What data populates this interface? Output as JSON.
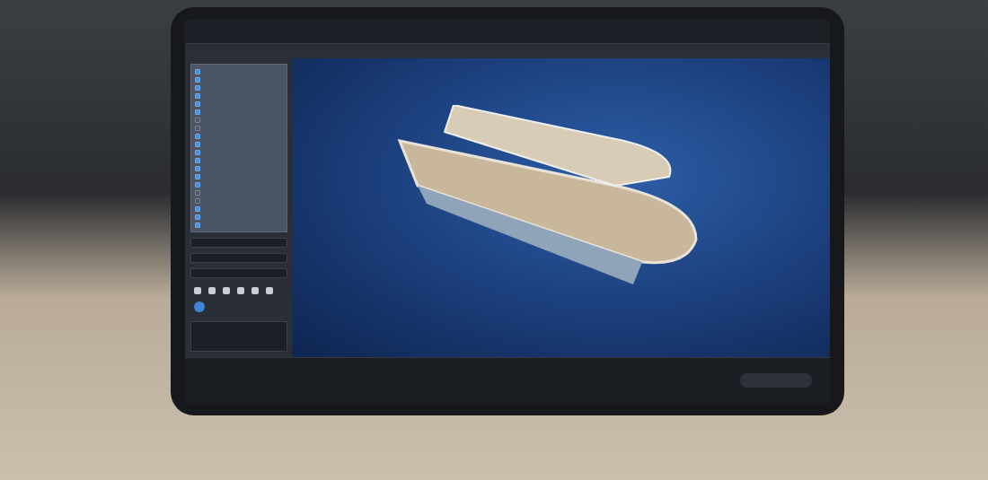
{
  "sidebar": {
    "tree": [
      {
        "checked": true
      },
      {
        "checked": true
      },
      {
        "checked": true
      },
      {
        "checked": true
      },
      {
        "checked": true
      },
      {
        "checked": true
      },
      {
        "checked": false
      },
      {
        "checked": false
      },
      {
        "checked": true
      },
      {
        "checked": true
      },
      {
        "checked": true
      },
      {
        "checked": true
      },
      {
        "checked": true
      },
      {
        "checked": true
      },
      {
        "checked": true
      },
      {
        "checked": false
      },
      {
        "checked": false
      },
      {
        "checked": true
      },
      {
        "checked": true
      },
      {
        "checked": true
      }
    ],
    "playback_toggle": {
      "on": true
    }
  }
}
